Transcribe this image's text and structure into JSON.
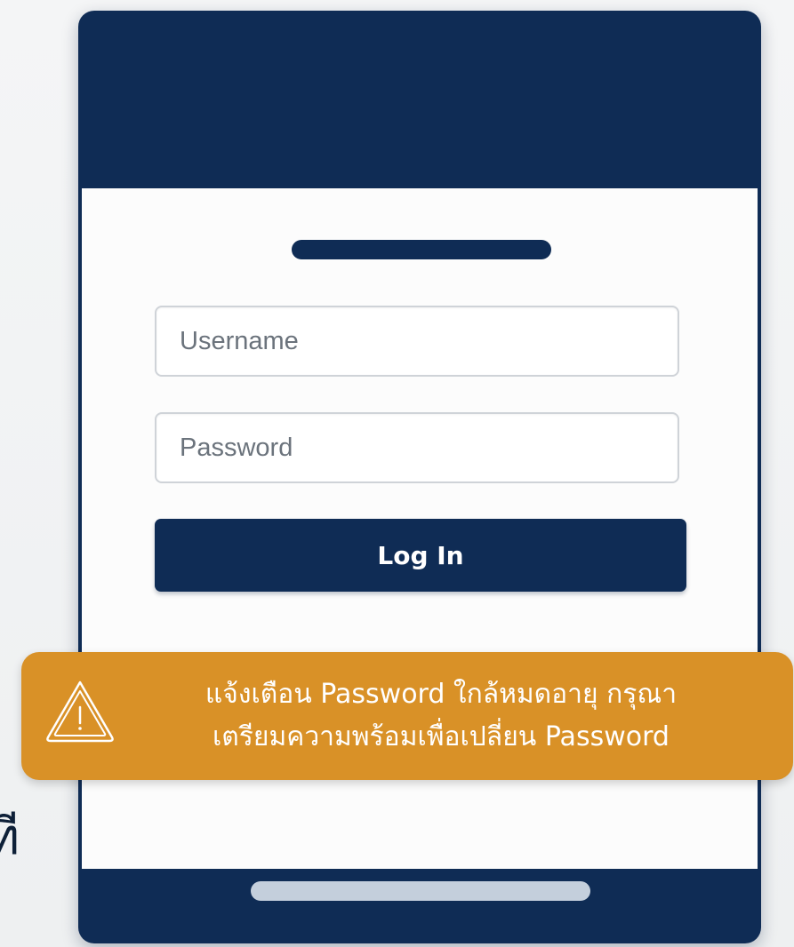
{
  "login_form": {
    "username_placeholder": "Username",
    "password_placeholder": "Password",
    "login_label": "Log In"
  },
  "alert": {
    "line1": "แจ้งเตือน Password ใกล้หมดอายุ กรุณา",
    "line2": "เตรียมความพร้อมเพื่อเปลี่ยน Password",
    "icon": "warning-icon"
  },
  "partial_text": "ที",
  "colors": {
    "primary": "#0f2c55",
    "alert_background": "#d99127",
    "home_indicator": "#c4cfdc"
  }
}
